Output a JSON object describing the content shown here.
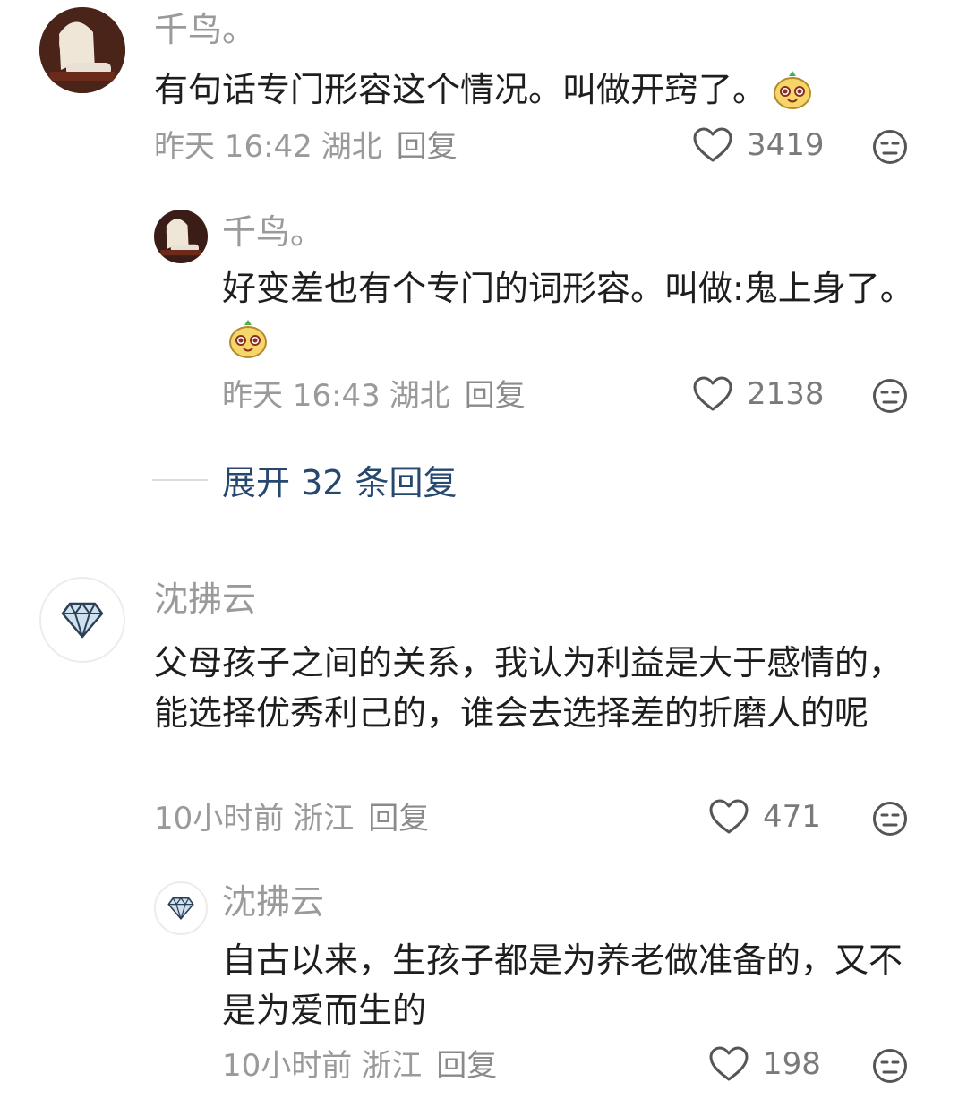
{
  "comments": [
    {
      "user": "千鸟。",
      "text": "有句话专门形容这个情况。叫做开窍了。",
      "emoji": "mango-emoji",
      "time": "昨天 16:42",
      "location": "湖北",
      "reply_label": "回复",
      "likes": "3419",
      "replies": [
        {
          "user": "千鸟。",
          "text": "好变差也有个专门的词形容。叫做:鬼上身了。",
          "emoji": "mango-emoji",
          "time": "昨天 16:43",
          "location": "湖北",
          "reply_label": "回复",
          "likes": "2138"
        }
      ],
      "expand_label": "展开 32 条回复"
    },
    {
      "user": "沈拂云",
      "text": "父母孩子之间的关系，我认为利益是大于感情的，能选择优秀利己的，谁会去选择差的折磨人的呢",
      "time": "10小时前",
      "location": "浙江",
      "reply_label": "回复",
      "likes": "471",
      "replies": [
        {
          "user": "沈拂云",
          "text": "自古以来，生孩子都是为养老做准备的，又不是为爱而生的",
          "time": "10小时前",
          "location": "浙江",
          "reply_label": "回复",
          "likes": "198"
        }
      ]
    }
  ],
  "colors": {
    "link": "#26486f",
    "meta": "#9a9a9a",
    "text": "#1e1e1e"
  }
}
